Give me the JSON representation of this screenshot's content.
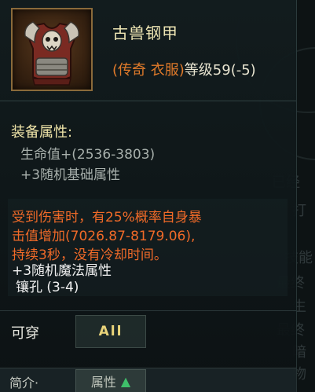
{
  "item": {
    "name": "古兽钢甲",
    "meta_open": "(",
    "meta_type": "传奇 衣服",
    "meta_close": ")",
    "meta_level": "等级59(-5)",
    "icon": "armor-icon"
  },
  "equip_attrs": {
    "heading": "装备属性:",
    "lines": [
      "生命值+(2536-3803)",
      "+3随机基础属性"
    ]
  },
  "special": {
    "lines": [
      "受到伤害时，有25%概率自身暴",
      "击值增加(7026.87-8179.06),",
      "持续3秒，没有冷却时间。"
    ]
  },
  "extra": {
    "magic_attr": "+3随机魔法属性",
    "sockets": "镶孔 (3-4)"
  },
  "wear": {
    "label": "可穿",
    "value": "All"
  },
  "bottom": {
    "left_text": "简介·",
    "tab_label": "属性",
    "tab_arrow": "▲"
  },
  "background_ghost": {
    "right_lines": [
      "已经",
      "打",
      "技能",
      "最终",
      "生",
      "最终",
      "暗",
      "物"
    ]
  },
  "colors": {
    "name": "#efe6b4",
    "legendary_orange": "#e07a2a",
    "effect_orange": "#f06a28",
    "heading_gold": "#efe4a8",
    "all_gold": "#e9d47a"
  }
}
